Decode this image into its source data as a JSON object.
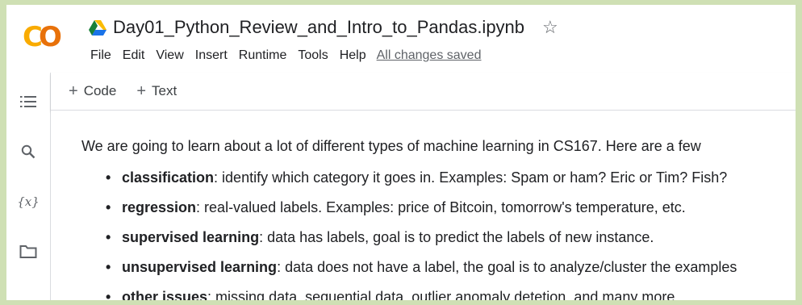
{
  "app": {
    "logo_text": "CO",
    "title": "Day01_Python_Review_and_Intro_to_Pandas.ipynb",
    "save_status": "All changes saved"
  },
  "menu": {
    "items": [
      "File",
      "Edit",
      "View",
      "Insert",
      "Runtime",
      "Tools",
      "Help"
    ]
  },
  "toolbar": {
    "add_code_label": "Code",
    "add_text_label": "Text"
  },
  "sidebar": {
    "items": [
      "table-of-contents-icon",
      "search-icon",
      "variables-icon",
      "folder-icon"
    ],
    "variables_glyph": "{x}"
  },
  "content": {
    "intro": "We are going to learn about a lot of different types of machine learning in CS167. Here are a few",
    "bullets": [
      {
        "term": "classification",
        "text": ": identify which category it goes in. Examples: Spam or ham? Eric or Tim? Fish?"
      },
      {
        "term": "regression",
        "text": ": real-valued labels. Examples: price of Bitcoin, tomorrow's temperature, etc."
      },
      {
        "term": "supervised learning",
        "text": ": data has labels, goal is to predict the labels of new instance."
      },
      {
        "term": "unsupervised learning",
        "text": ": data does not have a label, the goal is to analyze/cluster the examples"
      },
      {
        "term": "other issues",
        "text": ": missing data, sequential data, outlier anomaly detetion, and many more."
      }
    ]
  },
  "colors": {
    "logo_yellow": "#f9ab00",
    "logo_orange": "#e8710a",
    "frame_border": "#cfe0b4"
  }
}
